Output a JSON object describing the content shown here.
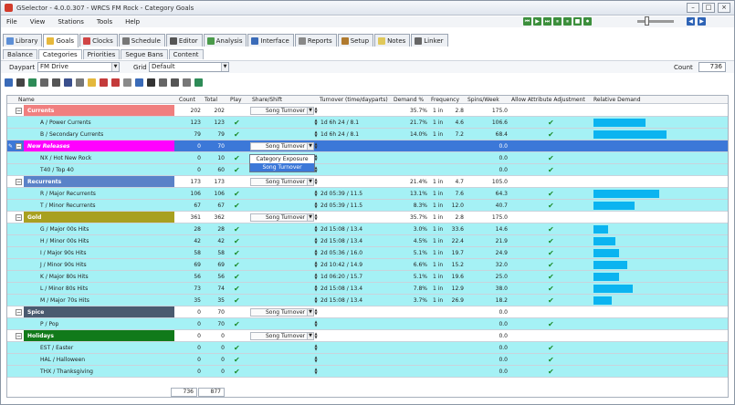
{
  "title": "GSelector - 4.0.0.307 - WRCS FM Rock - Category Goals",
  "menus": [
    "File",
    "View",
    "Stations",
    "Tools",
    "Help"
  ],
  "main_tabs": [
    "Library",
    "Goals",
    "Clocks",
    "Schedule",
    "Editor",
    "Analysis",
    "Interface",
    "Reports",
    "Setup",
    "Notes",
    "Linker"
  ],
  "sub_tabs": [
    "Balance",
    "Categories",
    "Priorities",
    "Segue Bans",
    "Content"
  ],
  "filter": {
    "daypart_label": "Daypart",
    "daypart_value": "FM Drive",
    "grid_label": "Grid",
    "grid_value": "Default",
    "count_label": "Count",
    "count_value": "736"
  },
  "columns": {
    "name": "Name",
    "count": "Count",
    "total": "Total",
    "play": "Play",
    "share": "Share/Shift",
    "turnover": "Turnover (time/dayparts)",
    "demand": "Demand %",
    "frequency": "Frequency",
    "spins": "Spins/Week",
    "allow": "Allow Attribute Adjustment",
    "relative": "Relative Demand"
  },
  "popup": {
    "item1": "Category Exposure",
    "item2": "Song Turnover"
  },
  "footer": {
    "count_total": "736",
    "total_total": "877"
  },
  "colors": {
    "currents": "#f07f7f",
    "new_releases": "#ff00ff",
    "recurrents": "#5a82c8",
    "gold": "#a8a020",
    "spice": "#4a5b70",
    "holidays": "#117a1a",
    "row_highlight": "#a5f1f5",
    "row_white": "#ffffff",
    "selected": "#3c78d8",
    "bar": "#0bb4f0"
  },
  "rows": [
    {
      "type": "cat",
      "name": "Currents",
      "count": "202",
      "total": "202",
      "share": "Song Turnover",
      "turnover": "",
      "demand": "35.7%",
      "freq_in": "1 in",
      "freq": "2.8",
      "spins": "175.0",
      "color": "#f07f7f"
    },
    {
      "type": "sub",
      "name": "A / Power Currents",
      "count": "123",
      "total": "123",
      "play": "✔",
      "turnover": "1d 6h 24 / 8.1",
      "demand": "21.7%",
      "freq_in": "1 in",
      "freq": "4.6",
      "spins": "106.6",
      "allow": "✔",
      "bar": 0.4
    },
    {
      "type": "sub",
      "name": "B / Secondary Currents",
      "count": "79",
      "total": "79",
      "play": "✔",
      "turnover": "1d 6h 24 / 8.1",
      "demand": "14.0%",
      "freq_in": "1 in",
      "freq": "7.2",
      "spins": "68.4",
      "allow": "✔",
      "bar": 0.56
    },
    {
      "type": "cat",
      "name": "New Releases",
      "count": "0",
      "total": "70",
      "share": "Song Turnover",
      "turnover": "",
      "demand": "",
      "freq_in": "",
      "freq": "",
      "spins": "0.0",
      "color": "#ff00ff",
      "selected": true
    },
    {
      "type": "sub",
      "name": "NX / Hot New Rock",
      "count": "0",
      "total": "10",
      "play": "✔",
      "turnover": "",
      "demand": "",
      "freq_in": "",
      "freq": "",
      "spins": "0.0",
      "allow": "✔"
    },
    {
      "type": "sub",
      "name": "T40 / Top 40",
      "count": "0",
      "total": "60",
      "play": "✔",
      "turnover": "",
      "demand": "",
      "freq_in": "",
      "freq": "",
      "spins": "0.0",
      "allow": "✔"
    },
    {
      "type": "cat",
      "name": "Recurrents",
      "count": "173",
      "total": "173",
      "share": "Song Turnover",
      "turnover": "",
      "demand": "21.4%",
      "freq_in": "1 in",
      "freq": "4.7",
      "spins": "105.0",
      "color": "#5a82c8"
    },
    {
      "type": "sub",
      "name": "R / Major Recurrents",
      "count": "106",
      "total": "106",
      "play": "✔",
      "turnover": "2d 05:39 / 11.5",
      "demand": "13.1%",
      "freq_in": "1 in",
      "freq": "7.6",
      "spins": "64.3",
      "allow": "✔",
      "bar": 0.51
    },
    {
      "type": "sub",
      "name": "T / Minor Recurrents",
      "count": "67",
      "total": "67",
      "play": "✔",
      "turnover": "2d 05:39 / 11.5",
      "demand": "8.3%",
      "freq_in": "1 in",
      "freq": "12.0",
      "spins": "40.7",
      "allow": "✔",
      "bar": 0.32
    },
    {
      "type": "cat",
      "name": "Gold",
      "count": "361",
      "total": "362",
      "share": "Song Turnover",
      "turnover": "",
      "demand": "35.7%",
      "freq_in": "1 in",
      "freq": "2.8",
      "spins": "175.0",
      "color": "#a8a020"
    },
    {
      "type": "sub",
      "name": "G / Major 00s Hits",
      "count": "28",
      "total": "28",
      "play": "✔",
      "turnover": "2d 15:08 / 13.4",
      "demand": "3.0%",
      "freq_in": "1 in",
      "freq": "33.6",
      "spins": "14.6",
      "allow": "✔",
      "bar": 0.11
    },
    {
      "type": "sub",
      "name": "H / Minor 00s Hits",
      "count": "42",
      "total": "42",
      "play": "✔",
      "turnover": "2d 15:08 / 13.4",
      "demand": "4.5%",
      "freq_in": "1 in",
      "freq": "22.4",
      "spins": "21.9",
      "allow": "✔",
      "bar": 0.17
    },
    {
      "type": "sub",
      "name": "I / Major 90s Hits",
      "count": "58",
      "total": "58",
      "play": "✔",
      "turnover": "2d 05:36 / 16.0",
      "demand": "5.1%",
      "freq_in": "1 in",
      "freq": "19.7",
      "spins": "24.9",
      "allow": "✔",
      "bar": 0.2
    },
    {
      "type": "sub",
      "name": "J / Minor 90s Hits",
      "count": "69",
      "total": "69",
      "play": "✔",
      "turnover": "2d 10:42 / 14.9",
      "demand": "6.6%",
      "freq_in": "1 in",
      "freq": "15.2",
      "spins": "32.0",
      "allow": "✔",
      "bar": 0.26
    },
    {
      "type": "sub",
      "name": "K / Major 80s Hits",
      "count": "56",
      "total": "56",
      "play": "✔",
      "turnover": "1d 06:20 / 15.7",
      "demand": "5.1%",
      "freq_in": "1 in",
      "freq": "19.6",
      "spins": "25.0",
      "allow": "✔",
      "bar": 0.2
    },
    {
      "type": "sub",
      "name": "L / Minor 80s Hits",
      "count": "73",
      "total": "74",
      "play": "✔",
      "turnover": "2d 15:08 / 13.4",
      "demand": "7.8%",
      "freq_in": "1 in",
      "freq": "12.9",
      "spins": "38.0",
      "allow": "✔",
      "bar": 0.3
    },
    {
      "type": "sub",
      "name": "M / Major 70s Hits",
      "count": "35",
      "total": "35",
      "play": "✔",
      "turnover": "2d 15:08 / 13.4",
      "demand": "3.7%",
      "freq_in": "1 in",
      "freq": "26.9",
      "spins": "18.2",
      "allow": "✔",
      "bar": 0.14
    },
    {
      "type": "cat",
      "name": "Spice",
      "count": "0",
      "total": "70",
      "share": "Song Turnover",
      "turnover": "",
      "demand": "",
      "freq_in": "",
      "freq": "",
      "spins": "0.0",
      "color": "#4a5b70"
    },
    {
      "type": "sub",
      "name": "P / Pop",
      "count": "0",
      "total": "70",
      "play": "✔",
      "turnover": "",
      "demand": "",
      "freq_in": "",
      "freq": "",
      "spins": "0.0",
      "allow": "✔"
    },
    {
      "type": "cat",
      "name": "Holidays",
      "count": "0",
      "total": "0",
      "share": "Song Turnover",
      "turnover": "",
      "demand": "",
      "freq_in": "",
      "freq": "",
      "spins": "0.0",
      "color": "#117a1a"
    },
    {
      "type": "sub",
      "name": "EST / Easter",
      "count": "0",
      "total": "0",
      "play": "✔",
      "turnover": "",
      "demand": "",
      "freq_in": "",
      "freq": "",
      "spins": "0.0",
      "allow": "✔"
    },
    {
      "type": "sub",
      "name": "HAL / Halloween",
      "count": "0",
      "total": "0",
      "play": "✔",
      "turnover": "",
      "demand": "",
      "freq_in": "",
      "freq": "",
      "spins": "0.0",
      "allow": "✔"
    },
    {
      "type": "sub",
      "name": "THX / Thanksgiving",
      "count": "0",
      "total": "0",
      "play": "✔",
      "turnover": "",
      "demand": "",
      "freq_in": "",
      "freq": "",
      "spins": "0.0",
      "allow": "✔"
    }
  ]
}
